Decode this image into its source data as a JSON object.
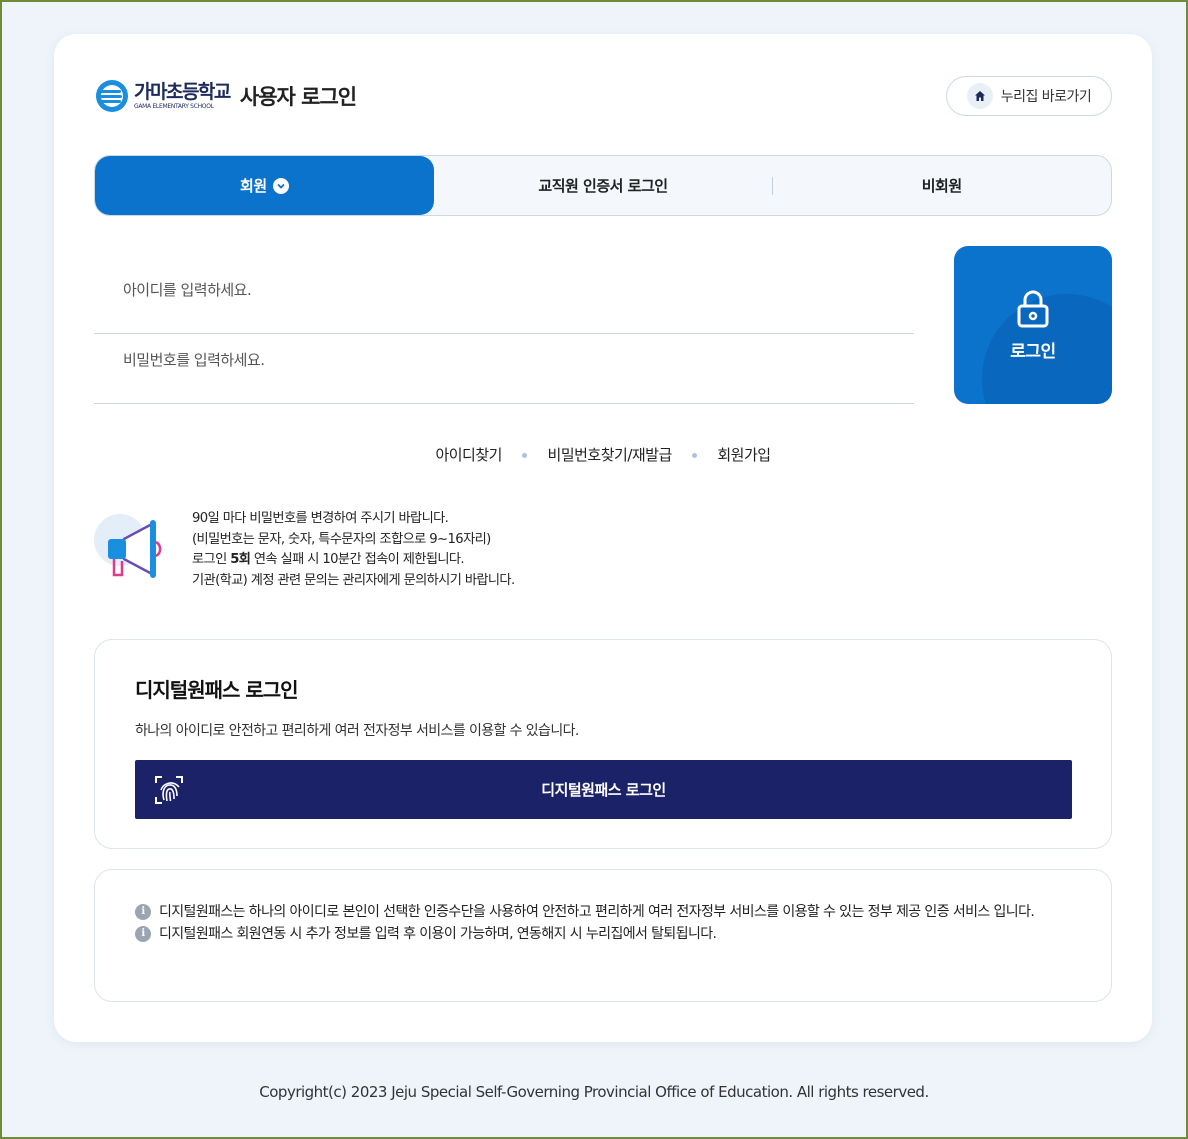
{
  "header": {
    "school_name": "가마초등학교",
    "school_name_en": "GAMA ELEMENTARY SCHOOL",
    "title": "사용자 로그인",
    "home_button_label": "누리집 바로가기"
  },
  "tabs": [
    {
      "label": "회원",
      "active": true
    },
    {
      "label": "교직원 인증서 로그인",
      "active": false
    },
    {
      "label": "비회원",
      "active": false
    }
  ],
  "form": {
    "id_placeholder": "아이디를 입력하세요.",
    "id_value": "",
    "password_placeholder": "비밀번호를 입력하세요.",
    "password_value": "",
    "login_button_label": "로그인"
  },
  "links": {
    "find_id": "아이디찾기",
    "find_password": "비밀번호찾기/재발급",
    "signup": "회원가입"
  },
  "notice": {
    "line1": "90일 마다 비밀번호를 변경하여 주시기 바랍니다.",
    "line2": "(비밀번호는 문자, 숫자, 특수문자의 조합으로 9~16자리)",
    "line3_prefix": "로그인 ",
    "line3_bold": "5회",
    "line3_suffix": " 연속 실패 시 10분간 접속이 제한됩니다.",
    "line4": "기관(학교) 계정 관련 문의는 관리자에게 문의하시기 바랍니다."
  },
  "digital_onepass": {
    "title": "디지털원패스 로그인",
    "description": "하나의 아이디로 안전하고 편리하게 여러 전자정부 서비스를 이용할 수 있습니다.",
    "button_label": "디지털원패스 로그인"
  },
  "info": {
    "item1": "디지털원패스는 하나의 아이디로 본인이 선택한 인증수단을 사용하여 안전하고 편리하게 여러 전자정부 서비스를 이용할 수 있는 정부 제공 인증 서비스 입니다.",
    "item2": "디지털원패스 회원연동 시 추가 정보를 입력 후 이용이 가능하며, 연동해지 시 누리집에서 탈퇴됩니다."
  },
  "footer": {
    "copyright": "Copyright(c) 2023 Jeju Special Self-Governing Provincial Office of Education. All rights reserved."
  },
  "colors": {
    "primary": "#0b73cc",
    "onepass": "#1c2268",
    "background": "#eef4fa"
  },
  "icons": [
    "school-logo-icon",
    "home-icon",
    "chevron-down-icon",
    "lock-icon",
    "megaphone-icon",
    "fingerprint-icon",
    "info-icon"
  ]
}
